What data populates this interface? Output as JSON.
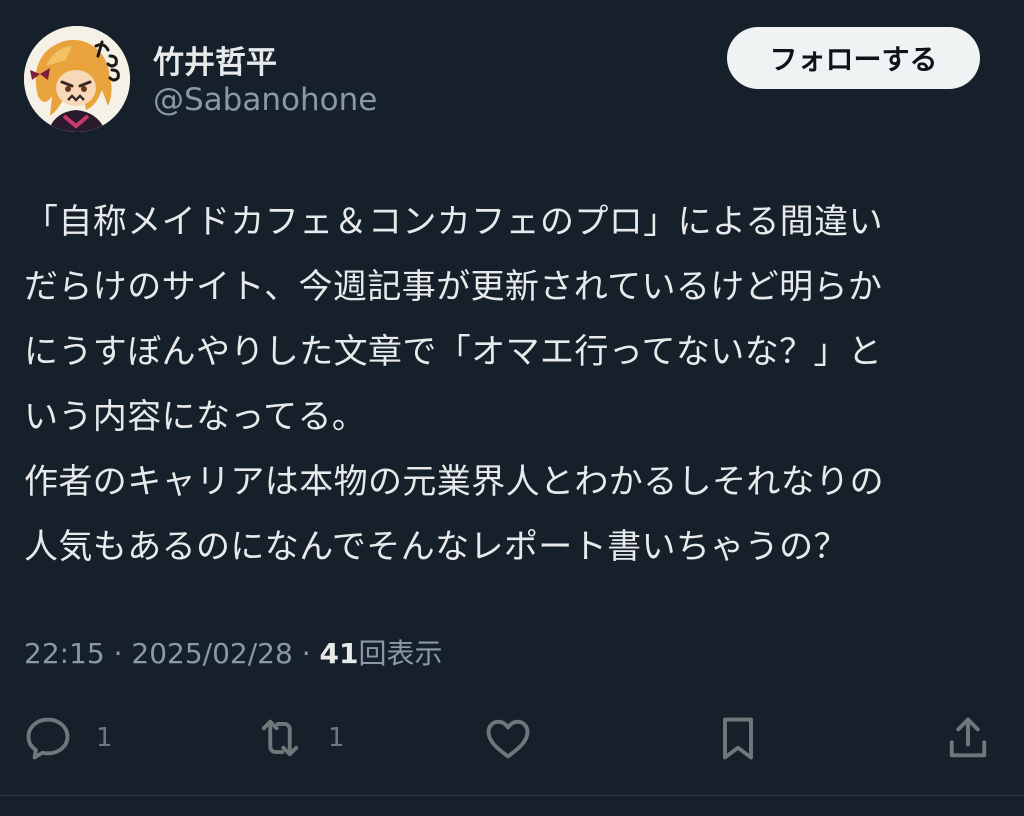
{
  "user": {
    "display_name": "竹井哲平",
    "handle": "@Sabanohone",
    "avatar_lettering": "かるる"
  },
  "follow_button_label": "フォローする",
  "tweet_text_lines": [
    "「自称メイドカフェ＆コンカフェのプロ」による間違い",
    "だらけのサイト、今週記事が更新されているけど明らか",
    "にうすぼんやりした文章で「オマエ行ってないな？」と",
    "いう内容になってる。",
    "作者のキャリアは本物の元業界人とわかるしそれなりの",
    "人気もあるのになんでそんなレポート書いちゃうの？"
  ],
  "meta": {
    "time": "22:15",
    "separator": " · ",
    "date": "2025/02/28",
    "views_count": "41",
    "views_label": "回表示"
  },
  "actions": {
    "reply_icon": "reply-icon",
    "reply_count": "1",
    "retweet_icon": "retweet-icon",
    "retweet_count": "1",
    "like_icon": "heart-icon",
    "bookmark_icon": "bookmark-icon",
    "share_icon": "share-icon"
  },
  "colors": {
    "background": "#15202b",
    "primary_text": "#e7e9ea",
    "secondary_text": "#8b98a5",
    "icon": "#71767b",
    "button_bg": "#eff3f4"
  }
}
